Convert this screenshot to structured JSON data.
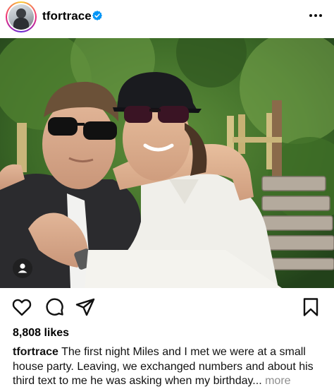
{
  "post": {
    "username": "tfortrace",
    "verified_icon": "verified-badge-icon",
    "more_icon": "more-options-icon",
    "likes": "8,808 likes",
    "caption_text": "The first night Miles and I met we were at a small house party. Leaving, we exchanged numbers and about his third text to me he was asking when my birthday...",
    "caption_more": "more"
  },
  "actions": {
    "like_icon": "heart-icon",
    "comment_icon": "comment-icon",
    "share_icon": "share-icon",
    "save_icon": "bookmark-icon"
  },
  "colors": {
    "verified_blue": "#0095f6",
    "muted_text": "#8e8e8e"
  }
}
